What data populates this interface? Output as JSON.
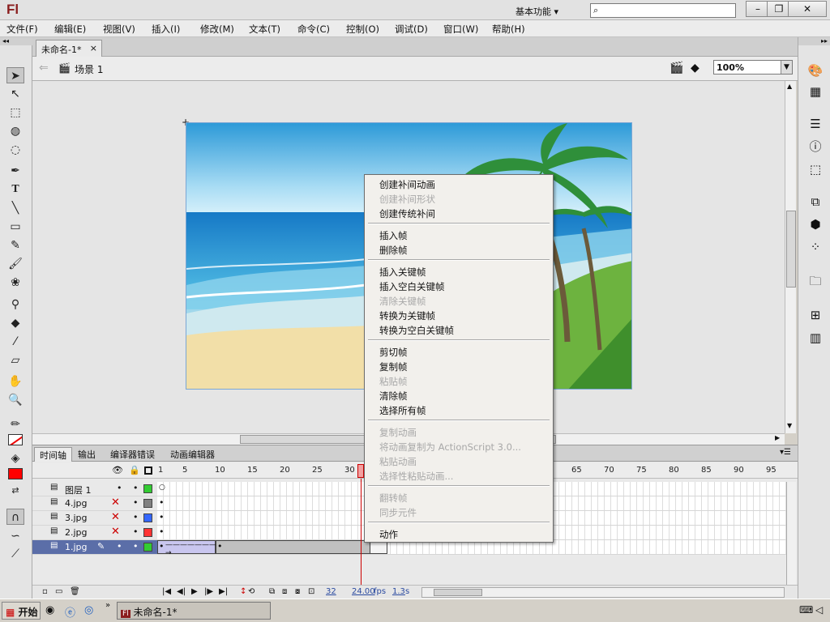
{
  "app": {
    "logo": "Fl",
    "workspace": "基本功能 ▾",
    "search_placeholder": ""
  },
  "window_buttons": {
    "minimize": "–",
    "restore": "❐",
    "close": "✕"
  },
  "menubar": [
    "文件(F)",
    "编辑(E)",
    "视图(V)",
    "插入(I)",
    "修改(M)",
    "文本(T)",
    "命令(C)",
    "控制(O)",
    "调试(D)",
    "窗口(W)",
    "帮助(H)"
  ],
  "document": {
    "tab": "未命名-1*",
    "tab_close": "×",
    "scene": "场景 1",
    "zoom": "100%"
  },
  "timeline": {
    "tabs": [
      "时间轴",
      "输出",
      "编译器错误",
      "动画编辑器"
    ],
    "frame_numbers": [
      "1",
      "5",
      "10",
      "15",
      "20",
      "25",
      "30",
      "65",
      "70",
      "75",
      "80",
      "85",
      "90",
      "95"
    ],
    "layers": [
      {
        "name": "图层 1",
        "color": "#33cc33",
        "hidden": false
      },
      {
        "name": "4.jpg",
        "color": "#808080",
        "hidden": true
      },
      {
        "name": "3.jpg",
        "color": "#3366ff",
        "hidden": true
      },
      {
        "name": "2.jpg",
        "color": "#ff3333",
        "hidden": true
      },
      {
        "name": "1.jpg",
        "color": "#33cc33",
        "hidden": false,
        "selected": true
      }
    ],
    "current_frame": "32",
    "fps": "24.00",
    "fps_unit": "fps",
    "time": "1.3",
    "time_unit": "s"
  },
  "context_menu": {
    "groups": [
      [
        {
          "label": "创建补间动画",
          "enabled": true
        },
        {
          "label": "创建补间形状",
          "enabled": false
        },
        {
          "label": "创建传统补间",
          "enabled": true
        }
      ],
      [
        {
          "label": "插入帧",
          "enabled": true
        },
        {
          "label": "删除帧",
          "enabled": true
        }
      ],
      [
        {
          "label": "插入关键帧",
          "enabled": true
        },
        {
          "label": "插入空白关键帧",
          "enabled": true
        },
        {
          "label": "清除关键帧",
          "enabled": false
        },
        {
          "label": "转换为关键帧",
          "enabled": true
        },
        {
          "label": "转换为空白关键帧",
          "enabled": true
        }
      ],
      [
        {
          "label": "剪切帧",
          "enabled": true
        },
        {
          "label": "复制帧",
          "enabled": true
        },
        {
          "label": "粘贴帧",
          "enabled": false
        },
        {
          "label": "清除帧",
          "enabled": true
        },
        {
          "label": "选择所有帧",
          "enabled": true
        }
      ],
      [
        {
          "label": "复制动画",
          "enabled": false
        },
        {
          "label": "将动画复制为 ActionScript 3.0...",
          "enabled": false
        },
        {
          "label": "粘贴动画",
          "enabled": false
        },
        {
          "label": "选择性粘贴动画...",
          "enabled": false
        }
      ],
      [
        {
          "label": "翻转帧",
          "enabled": false
        },
        {
          "label": "同步元件",
          "enabled": false
        }
      ],
      [
        {
          "label": "动作",
          "enabled": true
        }
      ]
    ]
  },
  "taskbar": {
    "start": "开始",
    "task": "未命名-1*"
  },
  "colors": {
    "stroke": "#000000",
    "fill": "#ff0000",
    "sky": "#3aa0e0",
    "sea": "#1f8fd0",
    "sand": "#f2dfa8"
  }
}
